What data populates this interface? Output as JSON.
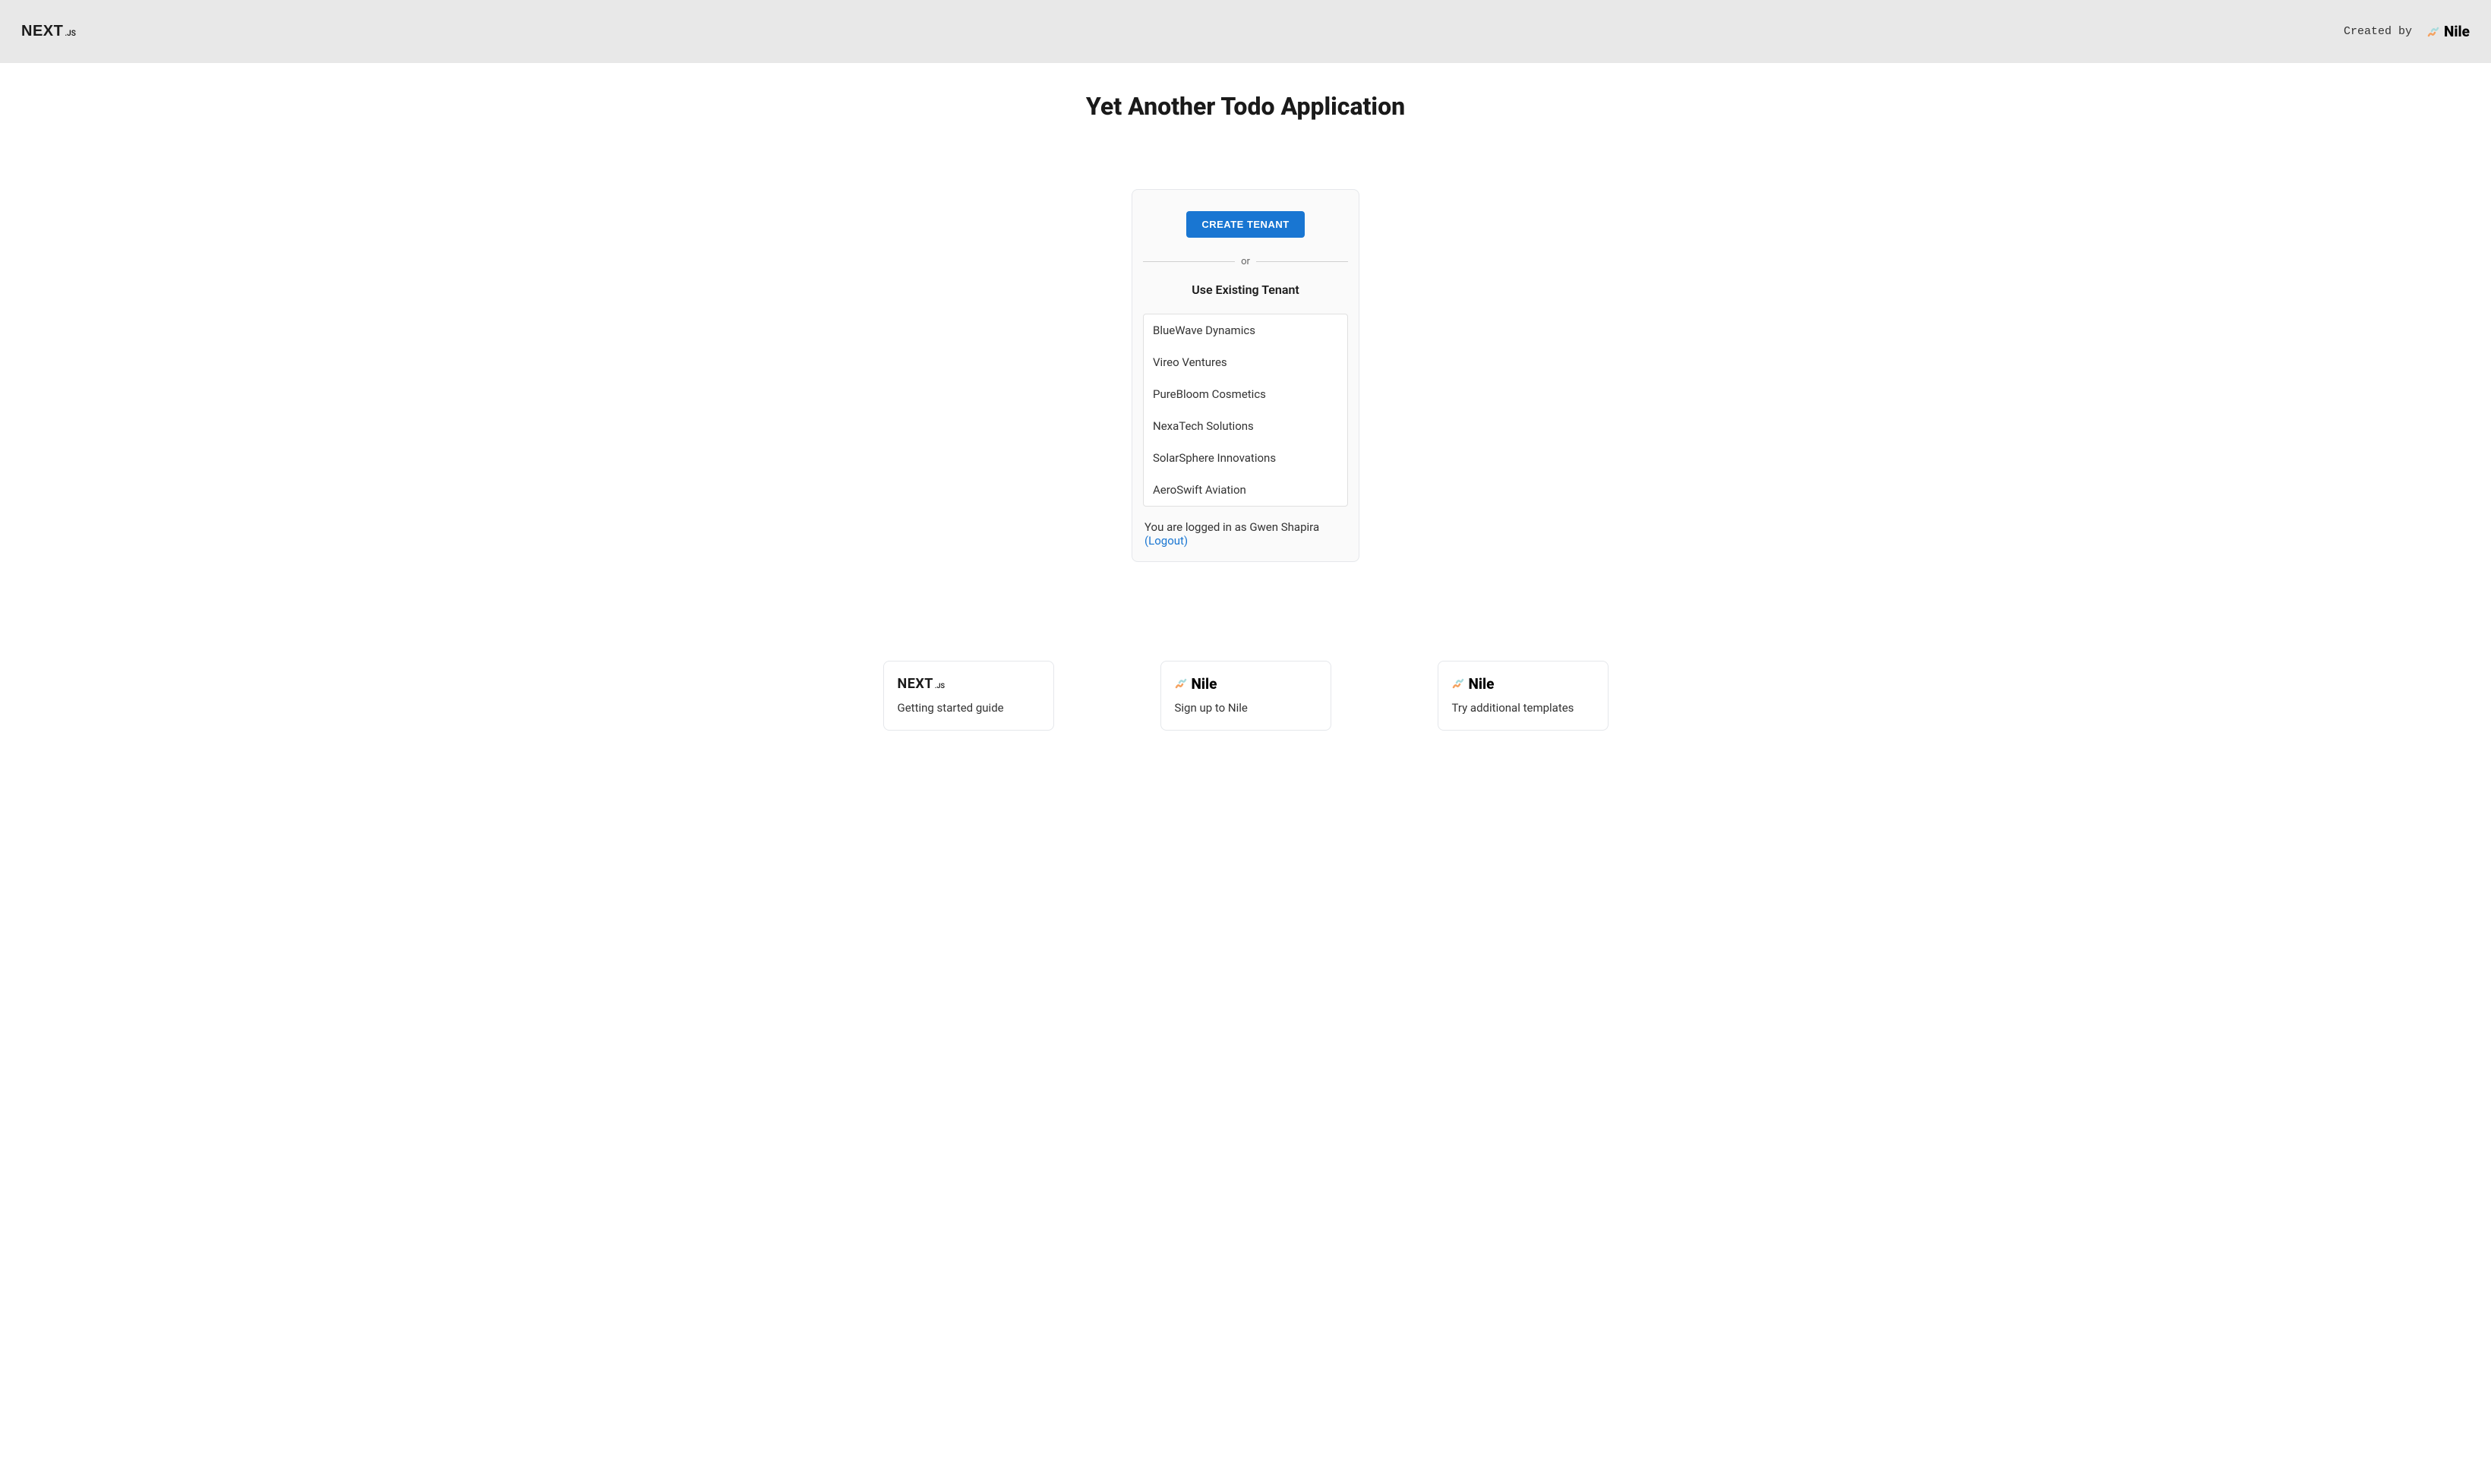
{
  "header": {
    "logo_main": "NEXT",
    "logo_suffix": ".JS",
    "created_by": "Created by",
    "nile_brand": "Nile"
  },
  "page": {
    "title": "Yet Another Todo Application"
  },
  "card": {
    "create_tenant_label": "CREATE TENANT",
    "divider_text": "or",
    "existing_title": "Use Existing Tenant",
    "tenants": [
      {
        "name": "BlueWave Dynamics"
      },
      {
        "name": "Vireo Ventures"
      },
      {
        "name": "PureBloom Cosmetics"
      },
      {
        "name": "NexaTech Solutions"
      },
      {
        "name": "SolarSphere Innovations"
      },
      {
        "name": "AeroSwift Aviation"
      }
    ],
    "login_status_prefix": "You are logged in as ",
    "logged_in_user": "Gwen Shapira",
    "logout_label": "(Logout)"
  },
  "bottom_cards": [
    {
      "logo_type": "nextjs",
      "logo_main": "NEXT",
      "logo_suffix": ".JS",
      "text": "Getting started guide"
    },
    {
      "logo_type": "nile",
      "logo_brand": "Nile",
      "text": "Sign up to Nile"
    },
    {
      "logo_type": "nile",
      "logo_brand": "Nile",
      "text": "Try additional templates"
    }
  ]
}
